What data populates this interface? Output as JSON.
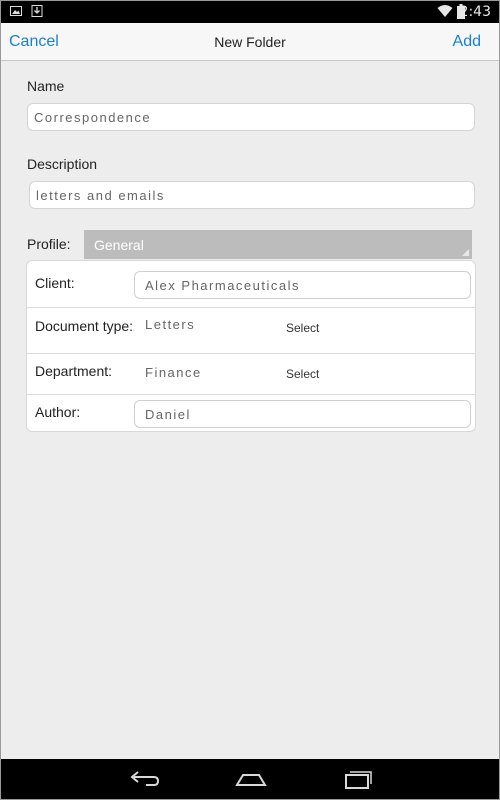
{
  "status_bar": {
    "time": "2:43",
    "left_icons": [
      "image-notification-icon",
      "download-notification-icon"
    ],
    "right_icons": [
      "wifi-icon",
      "battery-icon"
    ]
  },
  "nav": {
    "cancel_label": "Cancel",
    "title": "New Folder",
    "add_label": "Add",
    "accent_color": "#1a7fd4"
  },
  "form": {
    "name_label": "Name",
    "name_value": "Correspondence",
    "description_label": "Description",
    "description_value": "letters and emails",
    "profile_label": "Profile:",
    "profile_value": "General",
    "rows": [
      {
        "label": "Client:",
        "value": "Alex Pharmaceuticals"
      },
      {
        "label": "Document type:",
        "value": "Letters",
        "action": "Select"
      },
      {
        "label": "Department:",
        "value": "Finance",
        "action": "Select"
      },
      {
        "label": "Author:",
        "value": "Daniel"
      }
    ]
  },
  "system_nav": {
    "icons": [
      "back-icon",
      "home-icon",
      "recent-apps-icon"
    ]
  }
}
